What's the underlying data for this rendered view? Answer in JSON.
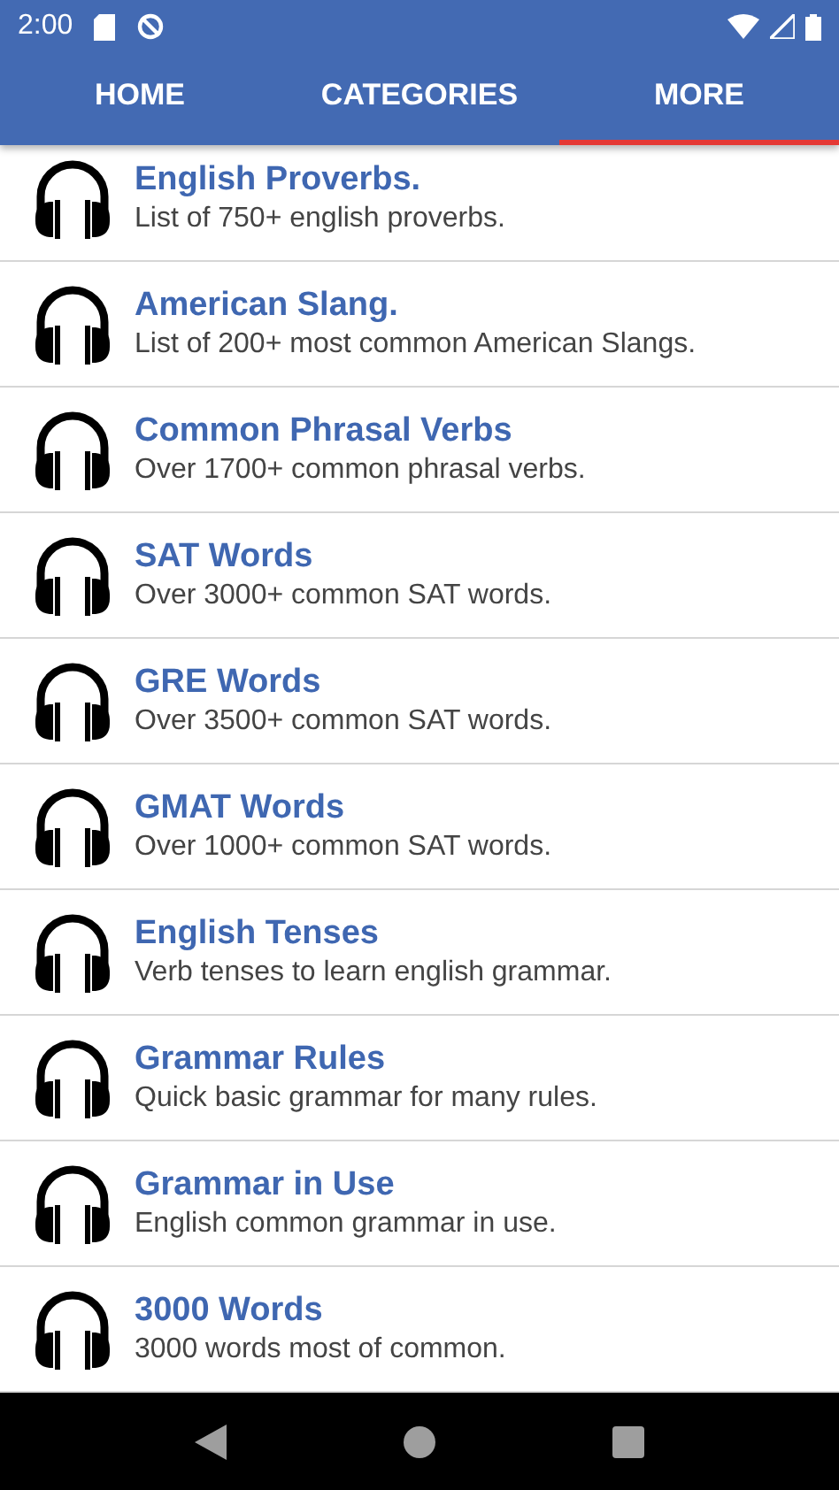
{
  "status_bar": {
    "time": "2:00"
  },
  "tabs": [
    {
      "label": "HOME",
      "selected": false
    },
    {
      "label": "CATEGORIES",
      "selected": false
    },
    {
      "label": "MORE",
      "selected": true
    }
  ],
  "items": [
    {
      "title": "English Proverbs.",
      "subtitle": "List of 750+ english proverbs."
    },
    {
      "title": "American Slang.",
      "subtitle": "List of 200+ most common American Slangs."
    },
    {
      "title": "Common Phrasal Verbs",
      "subtitle": "Over 1700+ common phrasal verbs."
    },
    {
      "title": "SAT Words",
      "subtitle": "Over 3000+ common SAT words."
    },
    {
      "title": "GRE Words",
      "subtitle": "Over 3500+ common SAT words."
    },
    {
      "title": "GMAT Words",
      "subtitle": "Over 1000+ common SAT words."
    },
    {
      "title": "English Tenses",
      "subtitle": "Verb tenses to learn english grammar."
    },
    {
      "title": "Grammar Rules",
      "subtitle": "Quick basic grammar for many rules."
    },
    {
      "title": "Grammar in Use",
      "subtitle": "English common grammar in use."
    },
    {
      "title": "3000 Words",
      "subtitle": "3000 words most of common."
    }
  ]
}
